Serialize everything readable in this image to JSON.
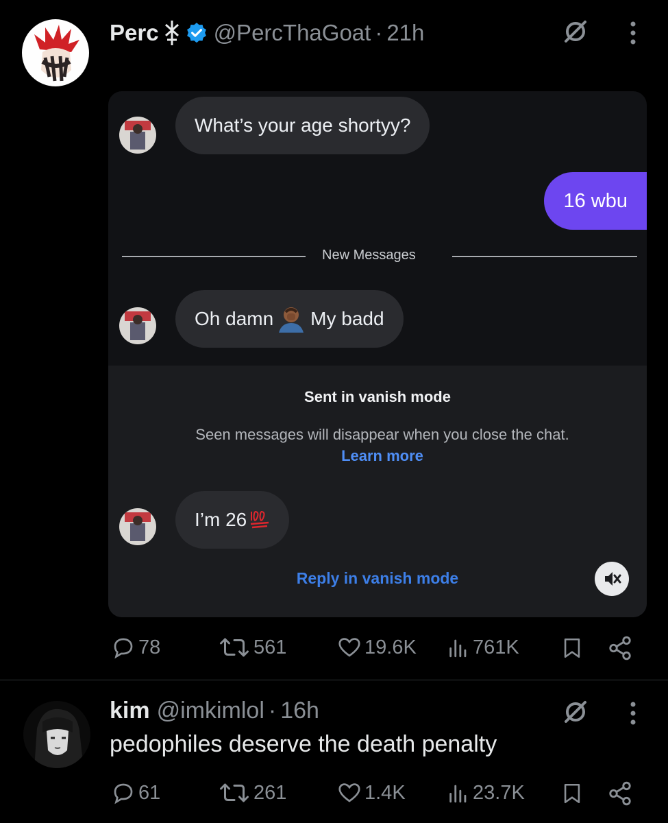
{
  "post": {
    "author": {
      "name": "Perc",
      "handle": "@PercThaGoat",
      "separator": "·",
      "time": "21h",
      "verified": true,
      "avatar_icon": "red-haired-anime-avatar",
      "name_emoji_icon": "berserk-brand-icon"
    },
    "dm": {
      "messages": [
        {
          "from": "them",
          "text": "What’s your age shortyy?"
        },
        {
          "from": "me",
          "text": "16 wbu"
        },
        {
          "from": "them",
          "text_before": "Oh damn",
          "emoji_icon": "facepalm-emoji",
          "text_after": "My badd"
        },
        {
          "from": "them",
          "text": "I’m 26",
          "emoji_icon": "hundred-points-emoji"
        }
      ],
      "divider_label": "New Messages",
      "vanish_title": "Sent in vanish mode",
      "vanish_description": "Seen messages will disappear when you close the chat.",
      "vanish_link": "Learn more",
      "reply_label": "Reply in vanish mode",
      "mute_icon": "speaker-muted-icon",
      "colors": {
        "outgoing_bubble": "#6d46f0",
        "link": "#4f8ef5"
      }
    },
    "actions": {
      "replies": "78",
      "reposts": "561",
      "likes": "19.6K",
      "views": "761K"
    }
  },
  "reply": {
    "author": {
      "name": "kim",
      "handle": "@imkimlol",
      "separator": "·",
      "time": "16h",
      "avatar_icon": "monochrome-girl-avatar"
    },
    "text": "pedophiles deserve the death penalty",
    "actions": {
      "replies": "61",
      "reposts": "261",
      "likes": "1.4K",
      "views": "23.7K"
    }
  },
  "icons": {
    "grok": "grok-icon",
    "more": "more-options-icon",
    "reply": "reply-icon",
    "repost": "repost-icon",
    "like": "like-icon",
    "views": "views-icon",
    "bookmark": "bookmark-icon",
    "share": "share-icon"
  }
}
